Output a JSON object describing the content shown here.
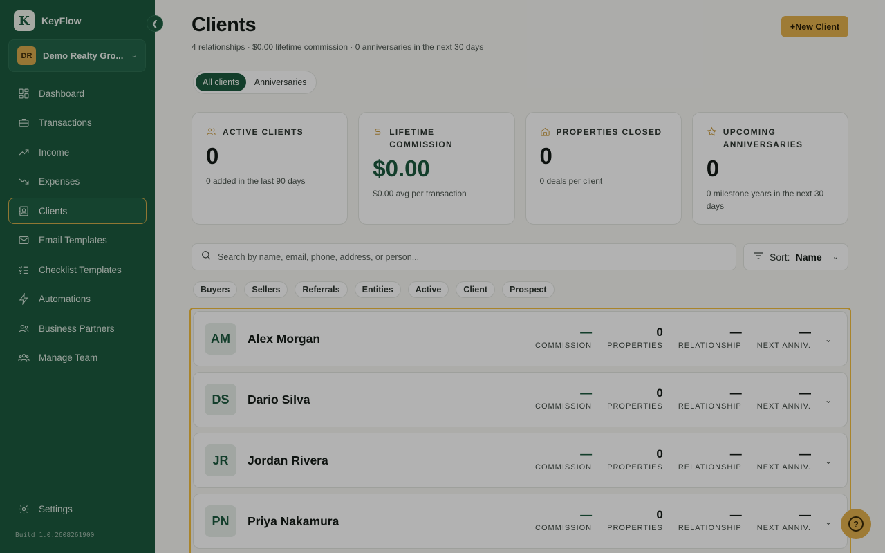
{
  "sidebar": {
    "brand": "KeyFlow",
    "brand_logo_letter": "K",
    "org": {
      "initials": "DR",
      "name": "Demo Realty Gro..."
    },
    "items": [
      {
        "label": "Dashboard",
        "icon": "dashboard-icon"
      },
      {
        "label": "Transactions",
        "icon": "briefcase-icon"
      },
      {
        "label": "Income",
        "icon": "trend-up-icon"
      },
      {
        "label": "Expenses",
        "icon": "trend-down-icon"
      },
      {
        "label": "Clients",
        "icon": "contacts-icon",
        "active": true
      },
      {
        "label": "Email Templates",
        "icon": "mail-icon"
      },
      {
        "label": "Checklist Templates",
        "icon": "checklist-icon"
      },
      {
        "label": "Automations",
        "icon": "bolt-icon"
      },
      {
        "label": "Business Partners",
        "icon": "handshake-icon"
      },
      {
        "label": "Manage Team",
        "icon": "team-icon"
      }
    ],
    "settings": "Settings",
    "build": "Build 1.0.2608261900"
  },
  "header": {
    "title": "Clients",
    "subtitle": "4 relationships · $0.00 lifetime commission · 0 anniversaries in the next 30 days",
    "new_button": "+New Client"
  },
  "tabs": [
    "All clients",
    "Anniversaries"
  ],
  "cards": [
    {
      "title": "ACTIVE CLIENTS",
      "value": "0",
      "note": "0 added in the last 90 days",
      "icon": "users-icon"
    },
    {
      "title": "LIFETIME COMMISSION",
      "value": "$0.00",
      "note": "$0.00 avg per transaction",
      "icon": "dollar-icon"
    },
    {
      "title": "PROPERTIES CLOSED",
      "value": "0",
      "note": "0 deals per client",
      "icon": "home-icon"
    },
    {
      "title": "UPCOMING ANNIVERSARIES",
      "value": "0",
      "note": "0 milestone years in the next 30 days",
      "icon": "star-icon"
    }
  ],
  "search": {
    "placeholder": "Search by name, email, phone, address, or person..."
  },
  "sort": {
    "label": "Sort:",
    "value": "Name"
  },
  "filters": [
    "Buyers",
    "Sellers",
    "Referrals",
    "Entities",
    "Active",
    "Client",
    "Prospect"
  ],
  "stat_labels": {
    "commission": "COMMISSION",
    "properties": "PROPERTIES",
    "relationship": "RELATIONSHIP",
    "next": "NEXT ANNIV."
  },
  "clients": [
    {
      "initials": "AM",
      "name": "Alex Morgan",
      "commission": "—",
      "properties": "0",
      "relationship": "—",
      "next": "—"
    },
    {
      "initials": "DS",
      "name": "Dario Silva",
      "commission": "—",
      "properties": "0",
      "relationship": "—",
      "next": "—"
    },
    {
      "initials": "JR",
      "name": "Jordan Rivera",
      "commission": "—",
      "properties": "0",
      "relationship": "—",
      "next": "—"
    },
    {
      "initials": "PN",
      "name": "Priya Nakamura",
      "commission": "—",
      "properties": "0",
      "relationship": "—",
      "next": "—"
    }
  ],
  "colors": {
    "brand_green": "#1c5a3e",
    "accent_gold": "#e3b04d",
    "highlight": "#f2bd3d"
  }
}
